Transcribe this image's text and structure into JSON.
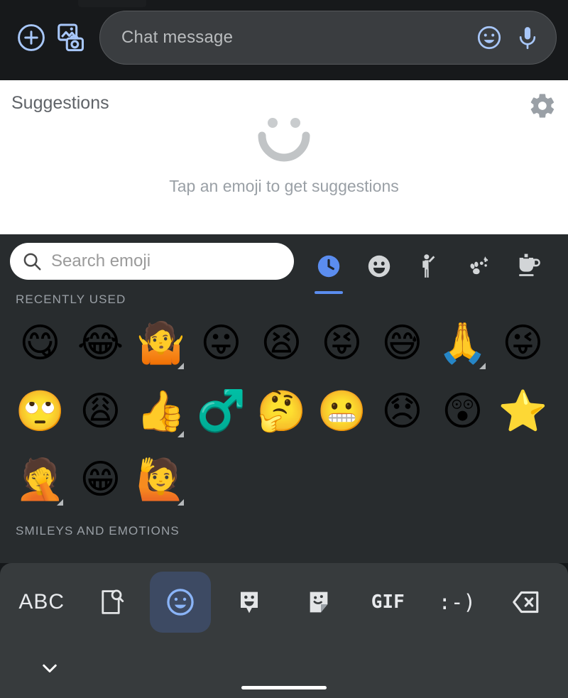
{
  "compose": {
    "add_icon": "plus-circle-icon",
    "gallery_icon": "image-camera-icon",
    "placeholder": "Chat message",
    "emoji_icon": "emoji-face-icon",
    "mic_icon": "microphone-icon",
    "accent_color": "#a8c7fa",
    "field_bg": "#3a3d40"
  },
  "suggestions": {
    "title": "Suggestions",
    "gear_icon": "gear-icon",
    "empty_text": "Tap an emoji to get suggestions",
    "empty_icon": "smiley-outline-icon",
    "bg": "#ffffff"
  },
  "keyboard": {
    "bg": "#282c2e",
    "search": {
      "placeholder": "Search emoji",
      "icon": "search-icon",
      "value": ""
    },
    "category_tabs": [
      {
        "name": "recently-used",
        "icon": "clock-icon",
        "active": true
      },
      {
        "name": "smileys-and-emotions",
        "icon": "smiley-face-icon",
        "active": false
      },
      {
        "name": "people",
        "icon": "person-raising-hand-icon",
        "active": false
      },
      {
        "name": "animals-and-nature",
        "icon": "paw-flower-icon",
        "active": false
      },
      {
        "name": "food-and-drink",
        "icon": "cup-icon",
        "active": false
      }
    ],
    "active_tab_color": "#5b8def",
    "sections": [
      {
        "label": "RECENTLY USED",
        "rows": [
          [
            {
              "glyph": "😋",
              "name": "face-savoring-food",
              "variants": false
            },
            {
              "glyph": "😂",
              "name": "face-with-tears-of-joy",
              "variants": false
            },
            {
              "glyph": "🤷",
              "name": "person-shrugging",
              "variants": true
            },
            {
              "glyph": "😛",
              "name": "face-with-tongue",
              "variants": false
            },
            {
              "glyph": "😫",
              "name": "tired-face",
              "variants": false
            },
            {
              "glyph": "😝",
              "name": "squinting-face-with-tongue",
              "variants": false
            },
            {
              "glyph": "😅",
              "name": "grinning-face-with-sweat",
              "variants": false
            },
            {
              "glyph": "🙏",
              "name": "folded-hands",
              "variants": true
            },
            {
              "glyph": "😜",
              "name": "winking-face-with-tongue",
              "variants": false
            }
          ],
          [
            {
              "glyph": "🙄",
              "name": "face-with-rolling-eyes",
              "variants": false
            },
            {
              "glyph": "😩",
              "name": "weary-face",
              "variants": false
            },
            {
              "glyph": "👍",
              "name": "thumbs-up",
              "variants": true
            },
            {
              "glyph": "♂️",
              "name": "male-sign",
              "variants": false
            },
            {
              "glyph": "🤔",
              "name": "thinking-face",
              "variants": false
            },
            {
              "glyph": "😬",
              "name": "grimacing-face",
              "variants": false
            },
            {
              "glyph": "😞",
              "name": "disappointed-face",
              "variants": false
            },
            {
              "glyph": "😲",
              "name": "astonished-face",
              "variants": false
            },
            {
              "glyph": "⭐",
              "name": "star",
              "variants": false
            }
          ],
          [
            {
              "glyph": "🤦",
              "name": "person-facepalming",
              "variants": true
            },
            {
              "glyph": "😁",
              "name": "beaming-face-with-smiling-eyes",
              "variants": false
            },
            {
              "glyph": "🙋",
              "name": "person-raising-hand",
              "variants": true
            }
          ]
        ]
      },
      {
        "label": "SMILEYS AND EMOTIONS",
        "rows": []
      }
    ]
  },
  "bottom_bar": {
    "bg": "#373b3d",
    "items": [
      {
        "label": "ABC",
        "name": "abc-keyboard-button",
        "icon": "text",
        "active": false
      },
      {
        "label": "",
        "name": "universal-search-button",
        "icon": "document-search-icon",
        "active": false
      },
      {
        "label": "",
        "name": "emoji-button",
        "icon": "emoji-face-icon",
        "active": true
      },
      {
        "label": "",
        "name": "emoji-kitchen-button",
        "icon": "sticker-face-icon",
        "active": false
      },
      {
        "label": "",
        "name": "stickers-button",
        "icon": "sticker-note-icon",
        "active": false
      },
      {
        "label": "GIF",
        "name": "gif-button",
        "icon": "text",
        "active": false
      },
      {
        "label": ":-)",
        "name": "emoticon-button",
        "icon": "text",
        "active": false
      },
      {
        "label": "",
        "name": "backspace-button",
        "icon": "backspace-icon",
        "active": false
      }
    ],
    "active_bg": "#3d4a63",
    "active_color": "#8ab4f8"
  },
  "nav": {
    "chevron_icon": "chevron-down-icon",
    "home_indicator": "home-bar"
  }
}
